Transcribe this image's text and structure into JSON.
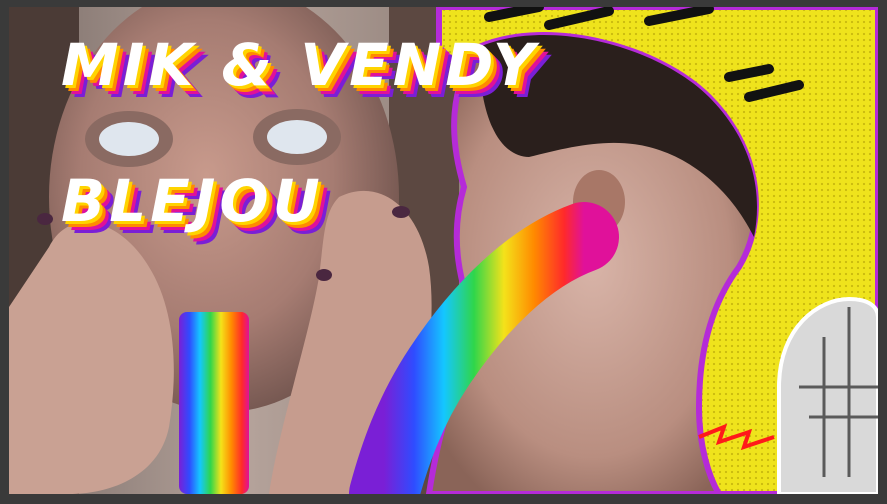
{
  "title": {
    "line1": "MIK & VENDY",
    "line2": "BLEJOU"
  },
  "image": {
    "subjects": [
      "woman-face",
      "man-profile",
      "rainbow-stream-left",
      "rainbow-stream-right",
      "yellow-halftone-panel"
    ]
  },
  "colors": {
    "title_fill": "#ffffff",
    "shadow_yellow": "#ffd400",
    "shadow_orange": "#ff8a00",
    "shadow_magenta": "#e0119a",
    "shadow_purple": "#7a1fd6",
    "cutout_outline": "#b52bd8",
    "panel_yellow": "#efe31c"
  }
}
